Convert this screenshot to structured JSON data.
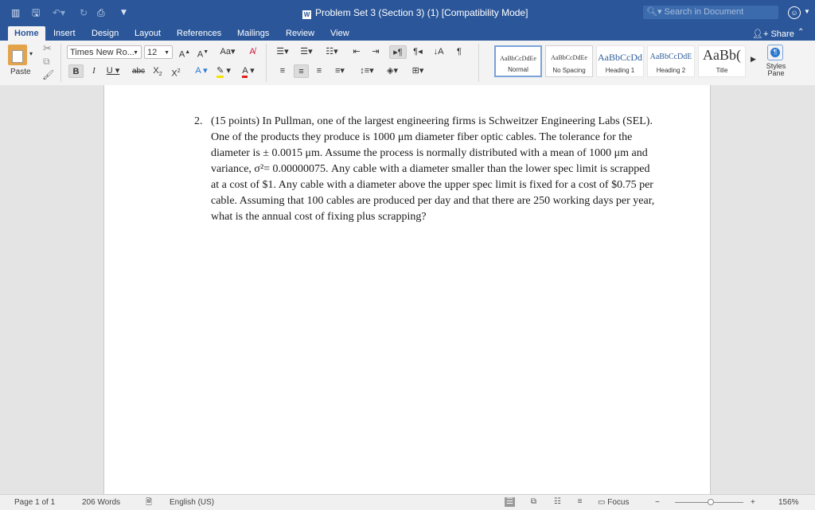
{
  "titlebar": {
    "title": "Problem Set 3 (Section 3) (1) [Compatibility Mode]",
    "search_placeholder": "Search in Document"
  },
  "tabs": [
    "Home",
    "Insert",
    "Design",
    "Layout",
    "References",
    "Mailings",
    "Review",
    "View"
  ],
  "active_tab": "Home",
  "share_label": "Share",
  "ribbon": {
    "paste_label": "Paste",
    "font_name": "Times New Ro...",
    "font_size": "12",
    "styles": [
      {
        "sample": "AaBbCcDdEe",
        "name": "Normal"
      },
      {
        "sample": "AaBbCcDdEe",
        "name": "No Spacing"
      },
      {
        "sample": "AaBbCcDd",
        "name": "Heading 1"
      },
      {
        "sample": "AaBbCcDdE",
        "name": "Heading 2"
      },
      {
        "sample": "AaBb(",
        "name": "Title"
      }
    ],
    "styles_pane_label": "Styles Pane"
  },
  "document": {
    "problem_number": "2.",
    "problem_text": "(15 points) In Pullman, one of the largest engineering firms is Schweitzer Engineering Labs (SEL). One of the products they produce is 1000 μm diameter fiber optic cables. The tolerance for the diameter is ± 0.0015 μm. Assume the process is normally distributed with a mean of 1000 μm and variance, σ²= 0.00000075. Any cable with a diameter smaller than the lower spec limit is scrapped at a cost of $1. Any cable with a diameter above the upper spec limit is fixed for a cost of $0.75 per cable. Assuming that 100 cables are produced per day and that there are 250 working days per year, what is the annual cost of fixing plus scrapping?"
  },
  "statusbar": {
    "page": "Page 1 of 1",
    "words": "206 Words",
    "language": "English (US)",
    "focus": "Focus",
    "zoom": "156%",
    "zoom_fraction": 0.52
  },
  "colors": {
    "brand": "#2b579a",
    "ribbon_bg": "#f3f3f3",
    "canvas_bg": "#e4e4e4"
  }
}
